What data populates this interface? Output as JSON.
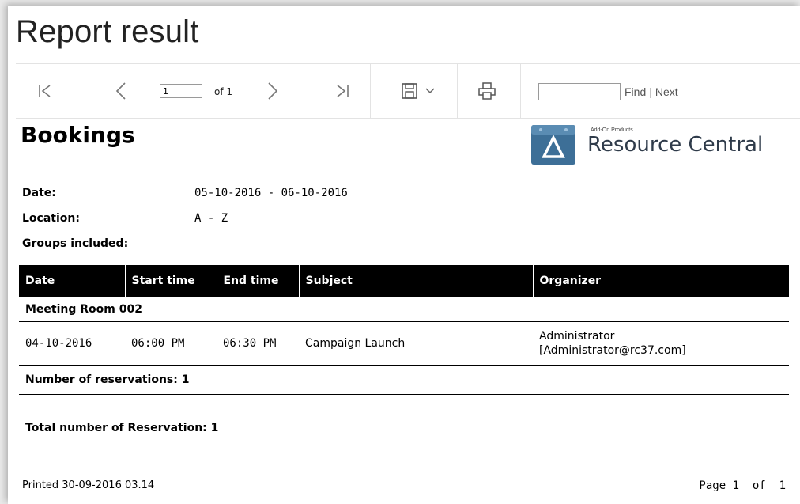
{
  "window": {
    "title": "Report result"
  },
  "toolbar": {
    "first_page_icon": "first-page-icon",
    "prev_page_icon": "previous-page-icon",
    "page_value": "1",
    "of_label": "of 1",
    "next_page_icon": "next-page-icon",
    "last_page_icon": "last-page-icon",
    "save_icon": "save-icon",
    "dropdown_icon": "chevron-down-icon",
    "print_icon": "print-icon",
    "find_value": "",
    "find_label": "Find",
    "separator": "|",
    "next_label": "Next"
  },
  "report": {
    "heading": "Bookings",
    "brand_small": "Add-On Products",
    "brand_name": "Resource Central",
    "meta": {
      "date_label": "Date:",
      "date_value": "05-10-2016 - 06-10-2016",
      "location_label": "Location:",
      "location_value": "A - Z",
      "groups_label": "Groups included:"
    },
    "table": {
      "headers": [
        "Date",
        "Start time",
        "End time",
        "Subject",
        "Organizer"
      ],
      "group_name": "Meeting Room 002",
      "row": {
        "date": "04-10-2016",
        "start": "06:00 PM",
        "end": "06:30 PM",
        "subject": "Campaign Launch",
        "organizer_name": "Administrator",
        "organizer_email": "[Administrator@rc37.com]"
      },
      "group_summary": "Number of reservations: 1",
      "total": "Total number of Reservation: 1"
    },
    "footer": {
      "printed": "Printed 30-09-2016 03.14",
      "page": "Page 1  of  1"
    }
  },
  "colors": {
    "header_bg": "#000000",
    "header_text": "#ffffff",
    "logo_blue": "#3d6f97"
  }
}
